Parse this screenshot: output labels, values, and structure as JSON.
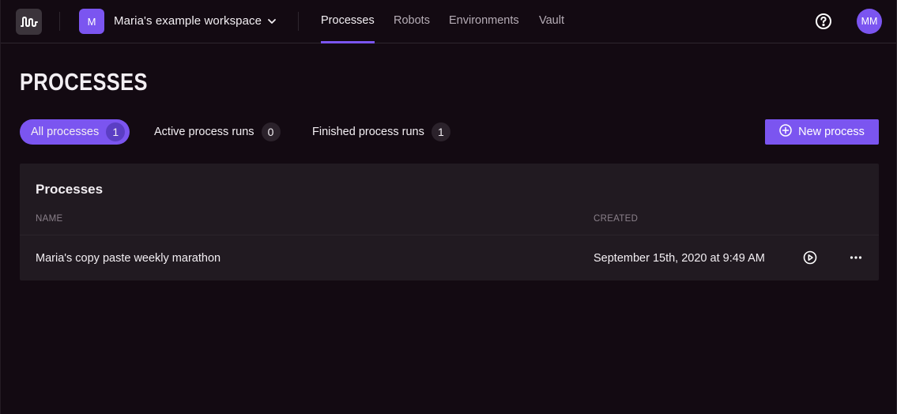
{
  "topbar": {
    "logo_icon": "waveform-logo-icon",
    "workspace": {
      "initial": "M",
      "name": "Maria's example workspace",
      "chevron_icon": "chevron-down-icon"
    },
    "nav": [
      {
        "label": "Processes",
        "active": true
      },
      {
        "label": "Robots",
        "active": false
      },
      {
        "label": "Environments",
        "active": false
      },
      {
        "label": "Vault",
        "active": false
      }
    ],
    "help_icon": "question-circle-icon",
    "user_initials": "MM"
  },
  "page": {
    "title": "PROCESSES",
    "filters": [
      {
        "label": "All processes",
        "count": "1",
        "active": true
      },
      {
        "label": "Active process runs",
        "count": "0",
        "active": false
      },
      {
        "label": "Finished process runs",
        "count": "1",
        "active": false
      }
    ],
    "new_button": {
      "label": "New process",
      "icon": "plus-circle-icon"
    }
  },
  "table": {
    "title": "Processes",
    "columns": [
      "NAME",
      "CREATED"
    ],
    "rows": [
      {
        "name": "Maria's copy paste weekly marathon",
        "created": "September 15th, 2020 at 9:49 AM"
      }
    ]
  },
  "colors": {
    "background": "#130a12",
    "accent": "#7b55f0",
    "card": "#211a21"
  }
}
